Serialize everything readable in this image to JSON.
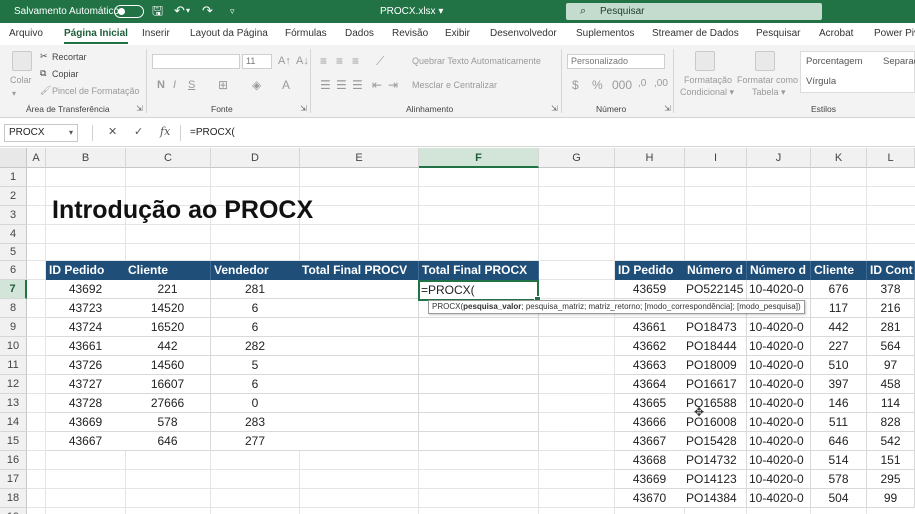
{
  "titlebar": {
    "autosave_label": "Salvamento Automático",
    "doc_title": "PROCX.xlsx ▾",
    "search_label": "Pesquisar"
  },
  "tabs": [
    {
      "label": "Arquivo",
      "active": false
    },
    {
      "label": "Página Inicial",
      "active": true
    },
    {
      "label": "Inserir",
      "active": false
    },
    {
      "label": "Layout da Página",
      "active": false
    },
    {
      "label": "Fórmulas",
      "active": false
    },
    {
      "label": "Dados",
      "active": false
    },
    {
      "label": "Revisão",
      "active": false
    },
    {
      "label": "Exibir",
      "active": false
    },
    {
      "label": "Desenvolvedor",
      "active": false
    },
    {
      "label": "Suplementos",
      "active": false
    },
    {
      "label": "Streamer de Dados",
      "active": false
    },
    {
      "label": "Pesquisar",
      "active": false
    },
    {
      "label": "Acrobat",
      "active": false
    },
    {
      "label": "Power Piv",
      "active": false
    }
  ],
  "ribbon": {
    "colar": "Colar",
    "recortar": "Recortar",
    "copiar": "Copiar",
    "pincel": "Pincel de Formatação",
    "group_clipboard": "Área de Transferência",
    "font_size": "11",
    "group_fonte": "Fonte",
    "quebrar": "Quebrar Texto Automaticamente",
    "mesclar": "Mesclar e Centralizar",
    "group_alinhamento": "Alinhamento",
    "number_format": "Personalizado",
    "group_numero": "Número",
    "formatacao_condicional": [
      "Formatação",
      "Condicional ▾"
    ],
    "formatar_tabela": [
      "Formatar como",
      "Tabela ▾"
    ],
    "style_porcentagem": "Porcentagem",
    "style_separador": "Separad",
    "style_virgula": "Vírgula",
    "group_estilos": "Estilos"
  },
  "formulabar": {
    "namebox": "PROCX",
    "formula": "=PROCX("
  },
  "columns": [
    "A",
    "B",
    "C",
    "D",
    "E",
    "F",
    "G",
    "H",
    "I",
    "J",
    "K",
    "L"
  ],
  "rows": [
    "1",
    "2",
    "3",
    "4",
    "5",
    "6",
    "7",
    "8",
    "9",
    "10",
    "11",
    "12",
    "13",
    "14",
    "15",
    "16",
    "17",
    "18",
    "19"
  ],
  "sheet": {
    "title": "Introdução ao PROCX",
    "left_table": {
      "headers": [
        "ID Pedido",
        "Cliente",
        "Vendedor",
        "Total Final PROCV",
        "Total Final PROCX"
      ],
      "rows": [
        [
          "43692",
          "221",
          "281",
          "",
          "=PROCX("
        ],
        [
          "43723",
          "14520",
          "6",
          "",
          ""
        ],
        [
          "43724",
          "16520",
          "6",
          "",
          ""
        ],
        [
          "43661",
          "442",
          "282",
          "",
          ""
        ],
        [
          "43726",
          "14560",
          "5",
          "",
          ""
        ],
        [
          "43727",
          "16607",
          "6",
          "",
          ""
        ],
        [
          "43728",
          "27666",
          "0",
          "",
          ""
        ],
        [
          "43669",
          "578",
          "283",
          "",
          ""
        ],
        [
          "43667",
          "646",
          "277",
          "",
          ""
        ]
      ]
    },
    "right_table": {
      "headers": [
        "ID Pedido",
        "Número d",
        "Número d",
        "Cliente",
        "ID Cont"
      ],
      "rows": [
        [
          "43659",
          "PO522145",
          "10-4020-0",
          "676",
          "378"
        ],
        [
          "",
          "",
          "",
          "117",
          "216"
        ],
        [
          "43661",
          "PO18473",
          "10-4020-0",
          "442",
          "281"
        ],
        [
          "43662",
          "PO18444",
          "10-4020-0",
          "227",
          "564"
        ],
        [
          "43663",
          "PO18009",
          "10-4020-0",
          "510",
          "97"
        ],
        [
          "43664",
          "PO16617",
          "10-4020-0",
          "397",
          "458"
        ],
        [
          "43665",
          "PO16588",
          "10-4020-0",
          "146",
          "114"
        ],
        [
          "43666",
          "PO16008",
          "10-4020-0",
          "511",
          "828"
        ],
        [
          "43667",
          "PO15428",
          "10-4020-0",
          "646",
          "542"
        ],
        [
          "43668",
          "PO14732",
          "10-4020-0",
          "514",
          "151"
        ],
        [
          "43669",
          "PO14123",
          "10-4020-0",
          "578",
          "295"
        ],
        [
          "43670",
          "PO14384",
          "10-4020-0",
          "504",
          "99"
        ]
      ]
    },
    "tooltip": {
      "fn": "PROCX(",
      "arg1": "pesquisa_valor",
      "rest": "; pesquisa_matriz; matriz_retorno; [modo_correspondência]; [modo_pesquisa])"
    }
  }
}
